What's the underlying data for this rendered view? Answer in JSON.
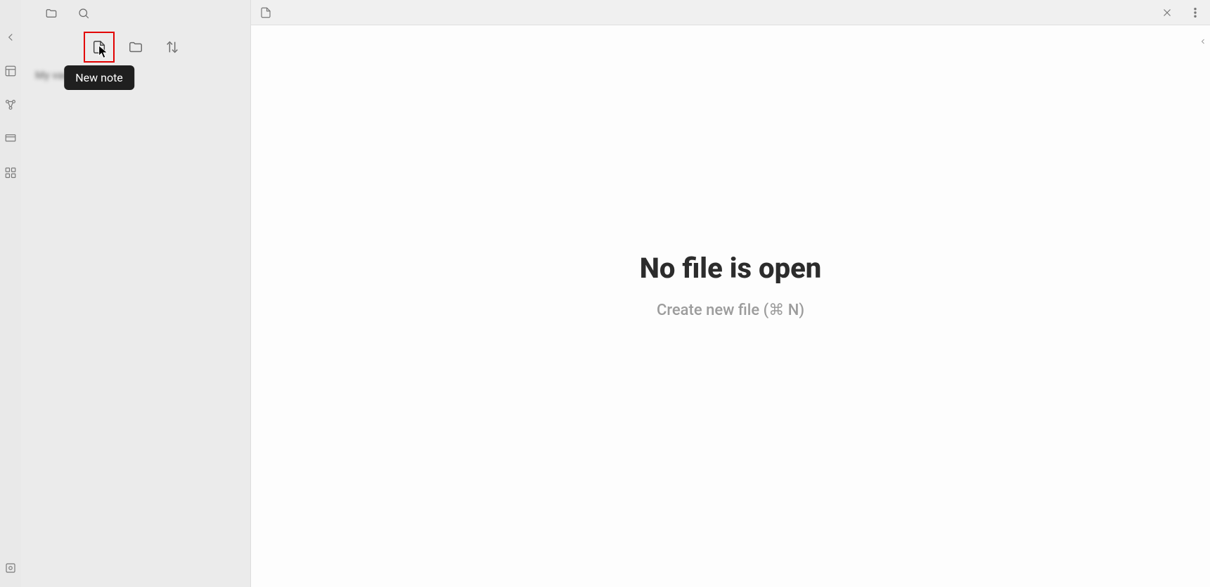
{
  "rail": {
    "items": [
      {
        "name": "back"
      },
      {
        "name": "quick-switcher"
      },
      {
        "name": "graph"
      },
      {
        "name": "canvas"
      },
      {
        "name": "command-palette"
      }
    ],
    "bottom": {
      "name": "vault-switcher"
    }
  },
  "sidebar": {
    "tabs": [
      {
        "name": "files",
        "active": true
      },
      {
        "name": "search",
        "active": false
      }
    ],
    "toolbar": {
      "new_note": {
        "tooltip": "New note"
      },
      "new_folder": {},
      "sort": {}
    },
    "vault_label": "My vault"
  },
  "main": {
    "tab_icon": "document",
    "close_icon": "close",
    "more_icon": "more-vertical",
    "empty": {
      "title": "No file is open",
      "subtitle": "Create new file (⌘ N)"
    }
  }
}
